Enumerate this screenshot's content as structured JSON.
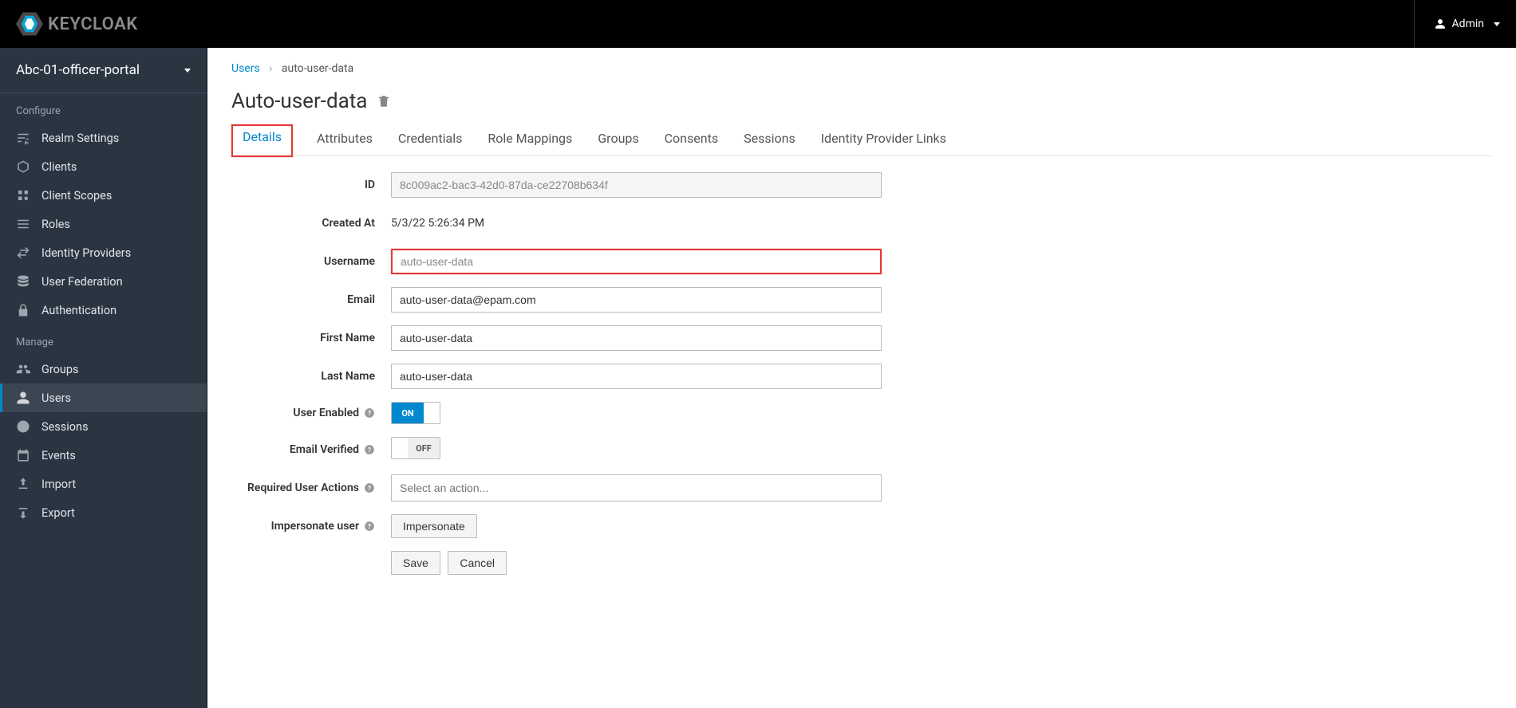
{
  "header": {
    "brand_text": "KEYCLOAK",
    "user_label": "Admin"
  },
  "sidebar": {
    "realm_name": "Abc-01-officer-portal",
    "configure_title": "Configure",
    "manage_title": "Manage",
    "configure": [
      {
        "label": "Realm Settings"
      },
      {
        "label": "Clients"
      },
      {
        "label": "Client Scopes"
      },
      {
        "label": "Roles"
      },
      {
        "label": "Identity Providers"
      },
      {
        "label": "User Federation"
      },
      {
        "label": "Authentication"
      }
    ],
    "manage": [
      {
        "label": "Groups"
      },
      {
        "label": "Users"
      },
      {
        "label": "Sessions"
      },
      {
        "label": "Events"
      },
      {
        "label": "Import"
      },
      {
        "label": "Export"
      }
    ]
  },
  "breadcrumb": {
    "parent": "Users",
    "current": "auto-user-data"
  },
  "page": {
    "title": "Auto-user-data"
  },
  "tabs": [
    {
      "label": "Details"
    },
    {
      "label": "Attributes"
    },
    {
      "label": "Credentials"
    },
    {
      "label": "Role Mappings"
    },
    {
      "label": "Groups"
    },
    {
      "label": "Consents"
    },
    {
      "label": "Sessions"
    },
    {
      "label": "Identity Provider Links"
    }
  ],
  "form": {
    "id_label": "ID",
    "id_value": "8c009ac2-bac3-42d0-87da-ce22708b634f",
    "created_at_label": "Created At",
    "created_at_value": "5/3/22 5:26:34 PM",
    "username_label": "Username",
    "username_value": "auto-user-data",
    "email_label": "Email",
    "email_value": "auto-user-data@epam.com",
    "first_name_label": "First Name",
    "first_name_value": "auto-user-data",
    "last_name_label": "Last Name",
    "last_name_value": "auto-user-data",
    "user_enabled_label": "User Enabled",
    "user_enabled_on": "ON",
    "email_verified_label": "Email Verified",
    "email_verified_off": "OFF",
    "required_actions_label": "Required User Actions",
    "required_actions_placeholder": "Select an action...",
    "impersonate_label": "Impersonate user",
    "impersonate_btn": "Impersonate",
    "save_btn": "Save",
    "cancel_btn": "Cancel"
  }
}
